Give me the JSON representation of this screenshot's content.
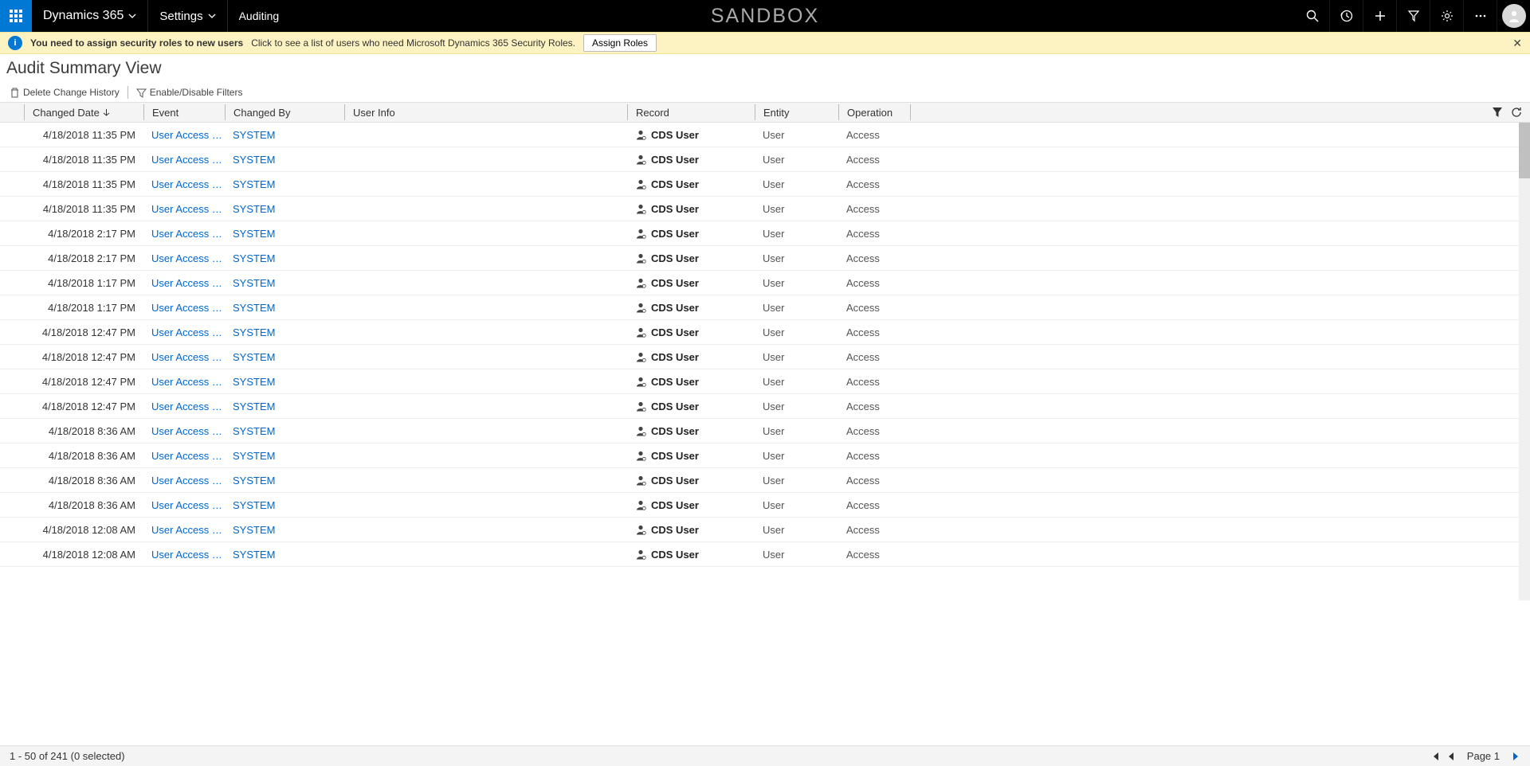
{
  "topbar": {
    "brand": "Dynamics 365",
    "nav_settings": "Settings",
    "nav_sub": "Auditing",
    "sandbox": "SANDBOX"
  },
  "notif": {
    "bold": "You need to assign security roles to new users",
    "desc": "Click to see a list of users who need Microsoft Dynamics 365 Security Roles.",
    "btn": "Assign Roles"
  },
  "view": {
    "title": "Audit Summary View",
    "tool_delete": "Delete Change History",
    "tool_filter": "Enable/Disable Filters"
  },
  "header": {
    "changed_date": "Changed Date",
    "event": "Event",
    "changed_by": "Changed By",
    "user_info": "User Info",
    "record": "Record",
    "entity": "Entity",
    "operation": "Operation"
  },
  "rows": [
    {
      "date": "4/18/2018 11:35 PM",
      "event": "User Access v...",
      "by": "SYSTEM",
      "record": "CDS User",
      "entity": "User",
      "op": "Access"
    },
    {
      "date": "4/18/2018 11:35 PM",
      "event": "User Access v...",
      "by": "SYSTEM",
      "record": "CDS User",
      "entity": "User",
      "op": "Access"
    },
    {
      "date": "4/18/2018 11:35 PM",
      "event": "User Access v...",
      "by": "SYSTEM",
      "record": "CDS User",
      "entity": "User",
      "op": "Access"
    },
    {
      "date": "4/18/2018 11:35 PM",
      "event": "User Access v...",
      "by": "SYSTEM",
      "record": "CDS User",
      "entity": "User",
      "op": "Access"
    },
    {
      "date": "4/18/2018 2:17 PM",
      "event": "User Access v...",
      "by": "SYSTEM",
      "record": "CDS User",
      "entity": "User",
      "op": "Access"
    },
    {
      "date": "4/18/2018 2:17 PM",
      "event": "User Access v...",
      "by": "SYSTEM",
      "record": "CDS User",
      "entity": "User",
      "op": "Access"
    },
    {
      "date": "4/18/2018 1:17 PM",
      "event": "User Access v...",
      "by": "SYSTEM",
      "record": "CDS User",
      "entity": "User",
      "op": "Access"
    },
    {
      "date": "4/18/2018 1:17 PM",
      "event": "User Access v...",
      "by": "SYSTEM",
      "record": "CDS User",
      "entity": "User",
      "op": "Access"
    },
    {
      "date": "4/18/2018 12:47 PM",
      "event": "User Access v...",
      "by": "SYSTEM",
      "record": "CDS User",
      "entity": "User",
      "op": "Access"
    },
    {
      "date": "4/18/2018 12:47 PM",
      "event": "User Access v...",
      "by": "SYSTEM",
      "record": "CDS User",
      "entity": "User",
      "op": "Access"
    },
    {
      "date": "4/18/2018 12:47 PM",
      "event": "User Access v...",
      "by": "SYSTEM",
      "record": "CDS User",
      "entity": "User",
      "op": "Access"
    },
    {
      "date": "4/18/2018 12:47 PM",
      "event": "User Access v...",
      "by": "SYSTEM",
      "record": "CDS User",
      "entity": "User",
      "op": "Access"
    },
    {
      "date": "4/18/2018 8:36 AM",
      "event": "User Access v...",
      "by": "SYSTEM",
      "record": "CDS User",
      "entity": "User",
      "op": "Access"
    },
    {
      "date": "4/18/2018 8:36 AM",
      "event": "User Access v...",
      "by": "SYSTEM",
      "record": "CDS User",
      "entity": "User",
      "op": "Access"
    },
    {
      "date": "4/18/2018 8:36 AM",
      "event": "User Access v...",
      "by": "SYSTEM",
      "record": "CDS User",
      "entity": "User",
      "op": "Access"
    },
    {
      "date": "4/18/2018 8:36 AM",
      "event": "User Access v...",
      "by": "SYSTEM",
      "record": "CDS User",
      "entity": "User",
      "op": "Access"
    },
    {
      "date": "4/18/2018 12:08 AM",
      "event": "User Access v...",
      "by": "SYSTEM",
      "record": "CDS User",
      "entity": "User",
      "op": "Access"
    },
    {
      "date": "4/18/2018 12:08 AM",
      "event": "User Access v...",
      "by": "SYSTEM",
      "record": "CDS User",
      "entity": "User",
      "op": "Access"
    }
  ],
  "footer": {
    "status": "1 - 50 of 241 (0 selected)",
    "page": "Page 1"
  }
}
